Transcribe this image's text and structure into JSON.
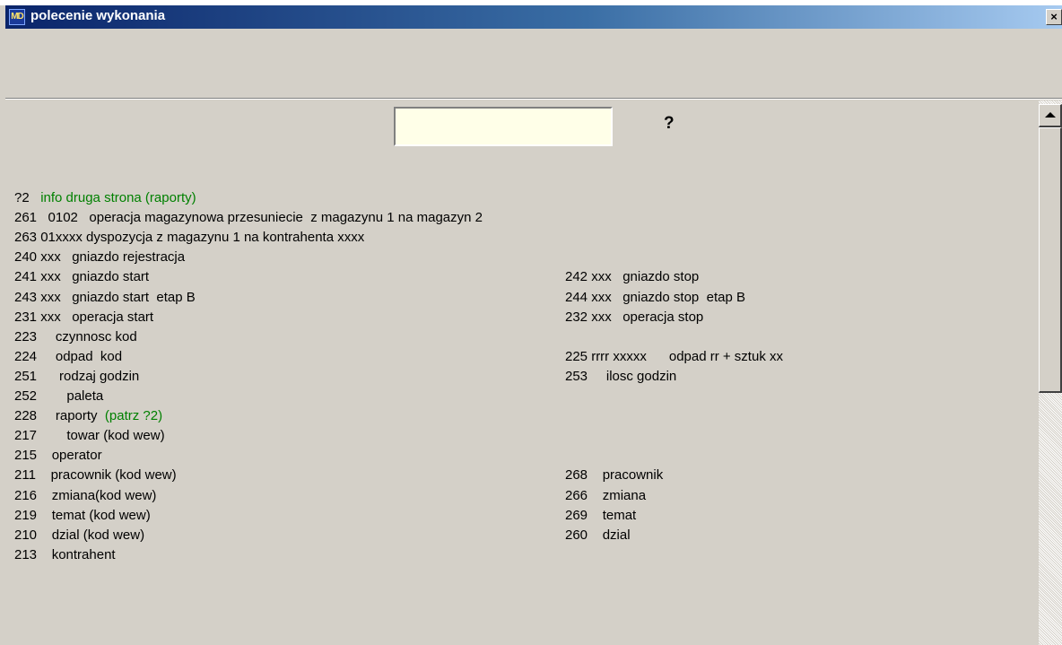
{
  "window": {
    "title": "polecenie wykonania",
    "icon_label": "MD",
    "close_label": "×"
  },
  "command": {
    "input_value": "",
    "help_label": "?"
  },
  "left_column": [
    {
      "text": "?2   ",
      "accent": "info druga strona (raporty)"
    },
    {
      "text": "261   0102   operacja magazynowa przesuniecie  z magazynu 1 na magazyn 2"
    },
    {
      "text": "263 01xxxx dyspozycja z magazynu 1 na kontrahenta xxxx"
    },
    {
      "text": "240 xxx   gniazdo rejestracja"
    },
    {
      "text": "241 xxx   gniazdo start"
    },
    {
      "text": "243 xxx   gniazdo start  etap B"
    },
    {
      "text": "231 xxx   operacja start"
    },
    {
      "text": "223     czynnosc kod"
    },
    {
      "text": "224     odpad  kod"
    },
    {
      "text": "251      rodzaj godzin"
    },
    {
      "text": "252        paleta"
    },
    {
      "text": "228     raporty  ",
      "accent": "(patrz ?2)"
    },
    {
      "text": "217        towar (kod wew)"
    },
    {
      "text": "215    operator"
    },
    {
      "text": "211    pracownik (kod wew)"
    },
    {
      "text": "216    zmiana(kod wew)"
    },
    {
      "text": "219    temat (kod wew)"
    },
    {
      "text": "210    dzial (kod wew)"
    },
    {
      "text": "213    kontrahent"
    }
  ],
  "right_column": [
    {
      "line": 4,
      "text": "242 xxx   gniazdo stop"
    },
    {
      "line": 5,
      "text": "244 xxx   gniazdo stop  etap B"
    },
    {
      "line": 6,
      "text": "232 xxx   operacja stop"
    },
    {
      "line": 8,
      "text": "225 rrrr xxxxx      odpad rr + sztuk xx"
    },
    {
      "line": 9,
      "text": "253     ilosc godzin"
    },
    {
      "line": 14,
      "text": "268    pracownik"
    },
    {
      "line": 15,
      "text": "266    zmiana"
    },
    {
      "line": 16,
      "text": "269    temat"
    },
    {
      "line": 17,
      "text": "260    dzial"
    }
  ],
  "colors": {
    "window_bg": "#d4d0c8",
    "title_gradient_start": "#0a246a",
    "title_gradient_end": "#a6caf0",
    "input_bg": "#ffffe8",
    "accent_green": "#008000"
  }
}
